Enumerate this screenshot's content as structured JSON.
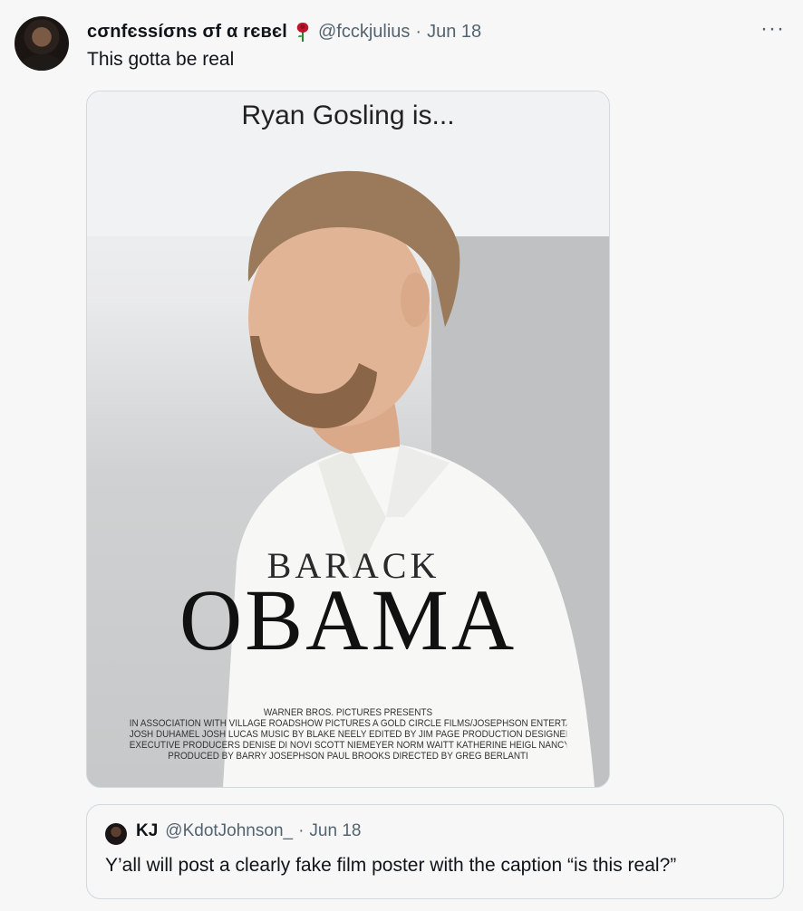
{
  "tweet": {
    "display_name": "cσnfєssíσns σf α rєвєl",
    "emoji_icon": "rose-icon",
    "handle": "@fcckjulius",
    "separator": "·",
    "date": "Jun 18",
    "more_label": "···",
    "text": "This gotta be real"
  },
  "poster": {
    "title": "Ryan Gosling is...",
    "first_name": "BARACK",
    "last_name": "OBAMA",
    "credits": [
      "WARNER BROS. PICTURES PRESENTS",
      "IN ASSOCIATION WITH VILLAGE ROADSHOW PICTURES A GOLD CIRCLE FILMS/JOSEPHSON ENTERTAINMENT PRODUCTION KATHERINE HEIGL \"LIFE AS WE KNOW IT\"",
      "JOSH DUHAMEL JOSH LUCAS MUSIC BY BLAKE NEELY EDITED BY JIM PAGE PRODUCTION DESIGNER MAHER AHMAD DIRECTOR OF PHOTOGRAPHY ANDREW DUNN",
      "EXECUTIVE PRODUCERS DENISE DI NOVI SCOTT NIEMEYER NORM WAITT KATHERINE HEIGL NANCY HEIGL AND BRUCE BERMAN WRITTEN BY IAN DEITCHMAN & KRISTIN RUSK ROBINSON",
      "PRODUCED BY BARRY JOSEPHSON PAUL BROOKS DIRECTED BY GREG BERLANTI"
    ]
  },
  "quote": {
    "display_name": "KJ",
    "handle": "@KdotJohnson_",
    "separator": "·",
    "date": "Jun 18",
    "text": "Y’all will post a clearly fake film poster with the caption “is this real?”"
  }
}
